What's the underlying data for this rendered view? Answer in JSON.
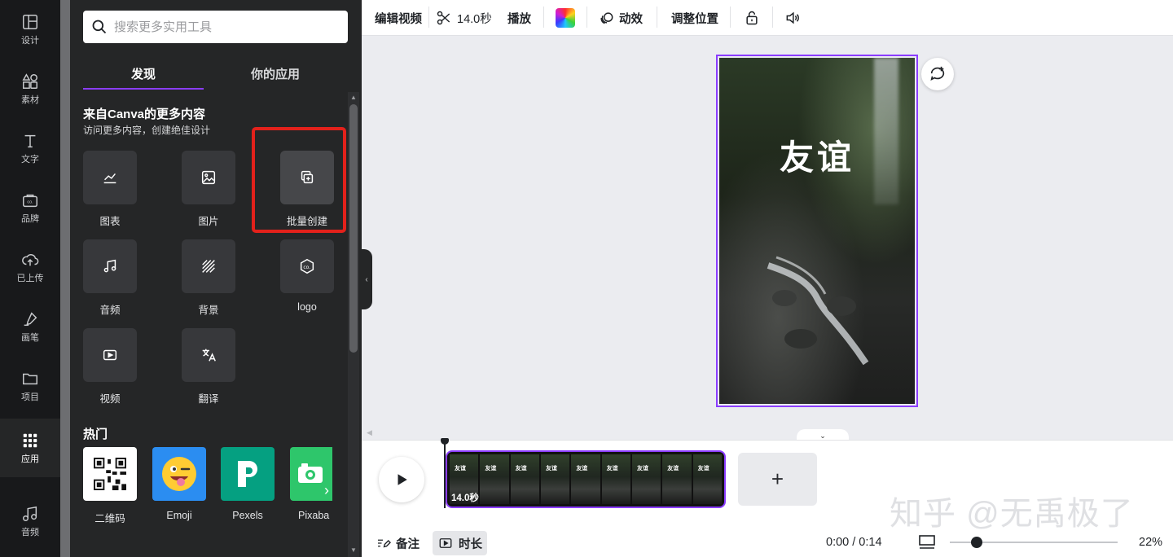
{
  "rail": {
    "items": [
      {
        "label": "设计",
        "icon": "layout-icon"
      },
      {
        "label": "素材",
        "icon": "shapes-icon"
      },
      {
        "label": "文字",
        "icon": "text-icon"
      },
      {
        "label": "品牌",
        "icon": "brand-icon"
      },
      {
        "label": "已上传",
        "icon": "upload-cloud-icon"
      },
      {
        "label": "画笔",
        "icon": "brush-icon"
      },
      {
        "label": "项目",
        "icon": "folder-icon"
      },
      {
        "label": "应用",
        "icon": "apps-grid-icon",
        "active": true
      },
      {
        "label": "音频",
        "icon": "music-icon"
      }
    ]
  },
  "panel": {
    "search_placeholder": "搜索更多实用工具",
    "tabs": [
      {
        "label": "发现",
        "active": true
      },
      {
        "label": "你的应用",
        "active": false
      }
    ],
    "section_title": "来自Canva的更多内容",
    "section_subtitle": "访问更多内容，创建绝佳设计",
    "tools": [
      {
        "label": "图表",
        "icon": "chart-icon"
      },
      {
        "label": "图片",
        "icon": "image-icon"
      },
      {
        "label": "批量创建",
        "icon": "bulk-create-icon",
        "highlighted": true
      },
      {
        "label": "音频",
        "icon": "music-note-icon"
      },
      {
        "label": "背景",
        "icon": "background-pattern-icon"
      },
      {
        "label": "logo",
        "icon": "logo-icon"
      },
      {
        "label": "视频",
        "icon": "video-play-icon"
      },
      {
        "label": "翻译",
        "icon": "translate-icon"
      }
    ],
    "hot_title": "热门",
    "apps": [
      {
        "label": "二维码",
        "icon": "qr-code-icon",
        "color": "#ffffff"
      },
      {
        "label": "Emoji",
        "icon": "emoji-icon",
        "color": "#2b8df1"
      },
      {
        "label": "Pexels",
        "icon": "pexels-icon",
        "color": "#05a081"
      },
      {
        "label": "Pixaba",
        "icon": "pixabay-icon",
        "color": "#2ec66b"
      }
    ]
  },
  "toolbar": {
    "edit_video": "编辑视频",
    "duration": "14.0秒",
    "playback": "播放",
    "animate": "动效",
    "position": "调整位置"
  },
  "canvas": {
    "overlay_text": "友谊"
  },
  "timeline": {
    "clip_duration": "14.0秒",
    "frame_text": "友谊",
    "frame_count": 9
  },
  "footer": {
    "notes": "备注",
    "duration": "时长",
    "time": "0:00 / 0:14",
    "zoom": "22%",
    "zoom_fraction": 0.22
  },
  "watermark": "知乎 @无禹极了"
}
